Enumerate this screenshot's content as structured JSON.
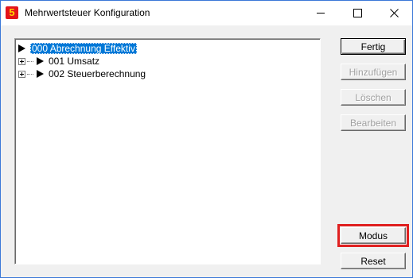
{
  "window": {
    "title": "Mehrwertsteuer Konfiguration",
    "app_icon_glyph": "5",
    "controls": [
      "minimize-icon",
      "maximize-icon",
      "close-icon"
    ]
  },
  "tree": {
    "root": {
      "label": "000 Abrechnung Effektiv",
      "selected": true
    },
    "children": [
      {
        "label": "001 Umsatz",
        "expandable": true
      },
      {
        "label": "002 Steuerberechnung",
        "expandable": true
      }
    ]
  },
  "buttons": {
    "fertig": "Fertig",
    "hinzufuegen": "Hinzufügen",
    "loeschen": "Löschen",
    "bearbeiten": "Bearbeiten",
    "modus": "Modus",
    "reset": "Reset"
  },
  "colors": {
    "selection": "#0078d7",
    "highlight": "#e02020",
    "app_icon_bg": "#e4141b",
    "app_icon_fg": "#ffd400"
  }
}
